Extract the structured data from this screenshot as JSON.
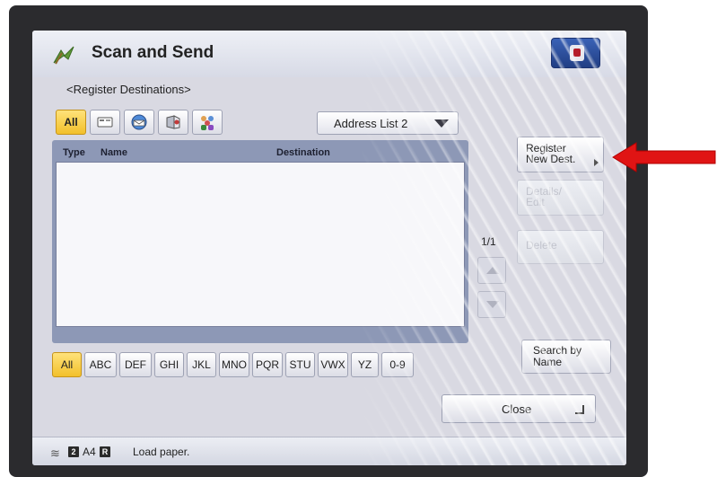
{
  "app": {
    "title": "Scan and Send",
    "subtitle": "<Register Destinations>"
  },
  "type_tabs": [
    {
      "label": "All",
      "icon": "all-label",
      "active": true
    },
    {
      "label": "",
      "icon": "fax-icon",
      "active": false
    },
    {
      "label": "",
      "icon": "email-icon",
      "active": false
    },
    {
      "label": "",
      "icon": "file-icon",
      "active": false
    },
    {
      "label": "",
      "icon": "group-icon",
      "active": false
    }
  ],
  "address_list": {
    "selected": "Address List 2"
  },
  "list": {
    "headers": {
      "type": "Type",
      "name": "Name",
      "destination": "Destination"
    },
    "rows": []
  },
  "pagination": {
    "counter": "1/1"
  },
  "side_buttons": {
    "register": "Register New Dest.",
    "details": "Details/ Edit",
    "delete": "Delete"
  },
  "alpha_filters": [
    "All",
    "ABC",
    "DEF",
    "GHI",
    "JKL",
    "MNO",
    "PQR",
    "STU",
    "VWX",
    "YZ",
    "0-9"
  ],
  "search_by_name": "Search by Name",
  "close": "Close",
  "status": {
    "badge_1": "2",
    "paper": "A4",
    "badge_2": "R",
    "message": "Load paper."
  },
  "colors": {
    "accent_yellow": "#f2c02b",
    "title_blue": "#213e84",
    "list_frame": "#8d98b6",
    "arrow_red": "#e01414"
  }
}
